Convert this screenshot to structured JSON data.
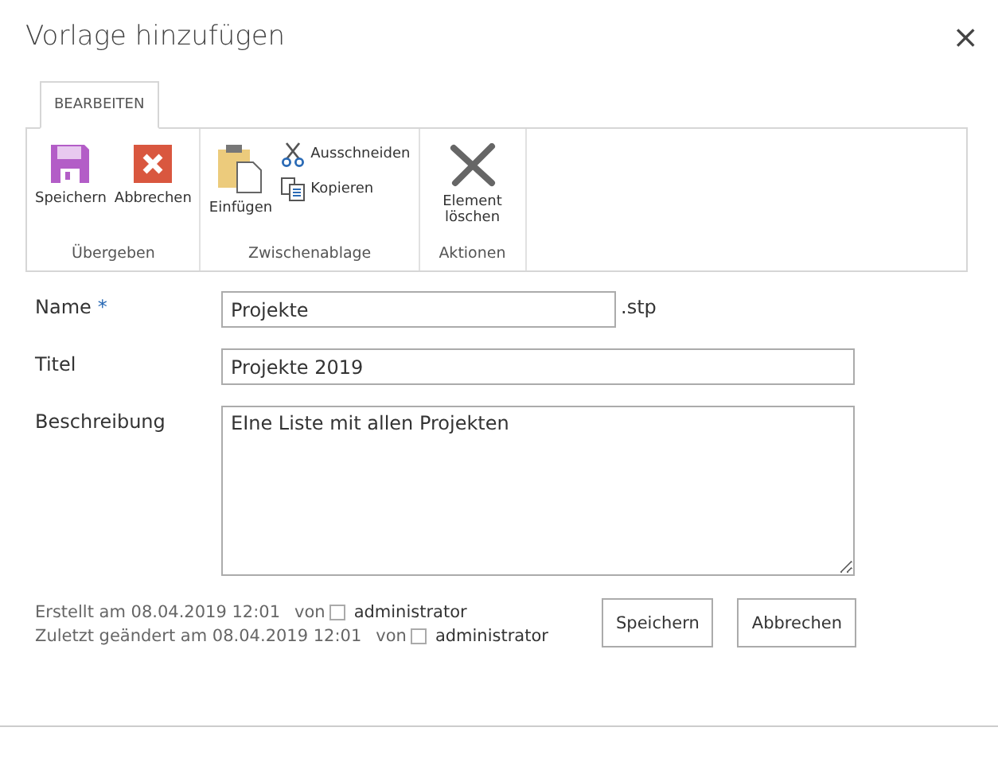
{
  "dialog": {
    "title": "Vorlage hinzufügen",
    "close": "×"
  },
  "tabs": [
    {
      "label": "BEARBEITEN",
      "selected": true
    }
  ],
  "ribbon_groups": [
    {
      "label": "Übergeben",
      "buttons": [
        {
          "label": "Speichern",
          "kind": "large"
        },
        {
          "label": "Abbrechen",
          "kind": "large"
        }
      ]
    },
    {
      "label": "Zwischenablage",
      "buttons": [
        {
          "label": "Einfügen",
          "kind": "large"
        },
        {
          "label": "Ausschneiden",
          "kind": "small"
        },
        {
          "label": "Kopieren",
          "kind": "small"
        }
      ]
    },
    {
      "label": "Aktionen",
      "buttons": [
        {
          "label": "Element löschen",
          "kind": "large"
        }
      ]
    }
  ],
  "fields": [
    {
      "label": "Name",
      "required_mark": "*",
      "kind": "short",
      "value": "Projekte",
      "suffix": ".stp"
    },
    {
      "label": "Titel",
      "kind": "text",
      "value": "Projekte 2019"
    },
    {
      "label": "Beschreibung",
      "kind": "multiline",
      "value": "EIne Liste mit allen Projekten"
    }
  ],
  "audit": [
    {
      "text": "Erstellt am 08.04.2019 12:01",
      "by": "von",
      "user": "administrator"
    },
    {
      "text": "Zuletzt geändert am 08.04.2019 12:01",
      "by": "von",
      "user": "administrator"
    }
  ],
  "buttons": [
    "Speichern",
    "Abbrechen"
  ]
}
